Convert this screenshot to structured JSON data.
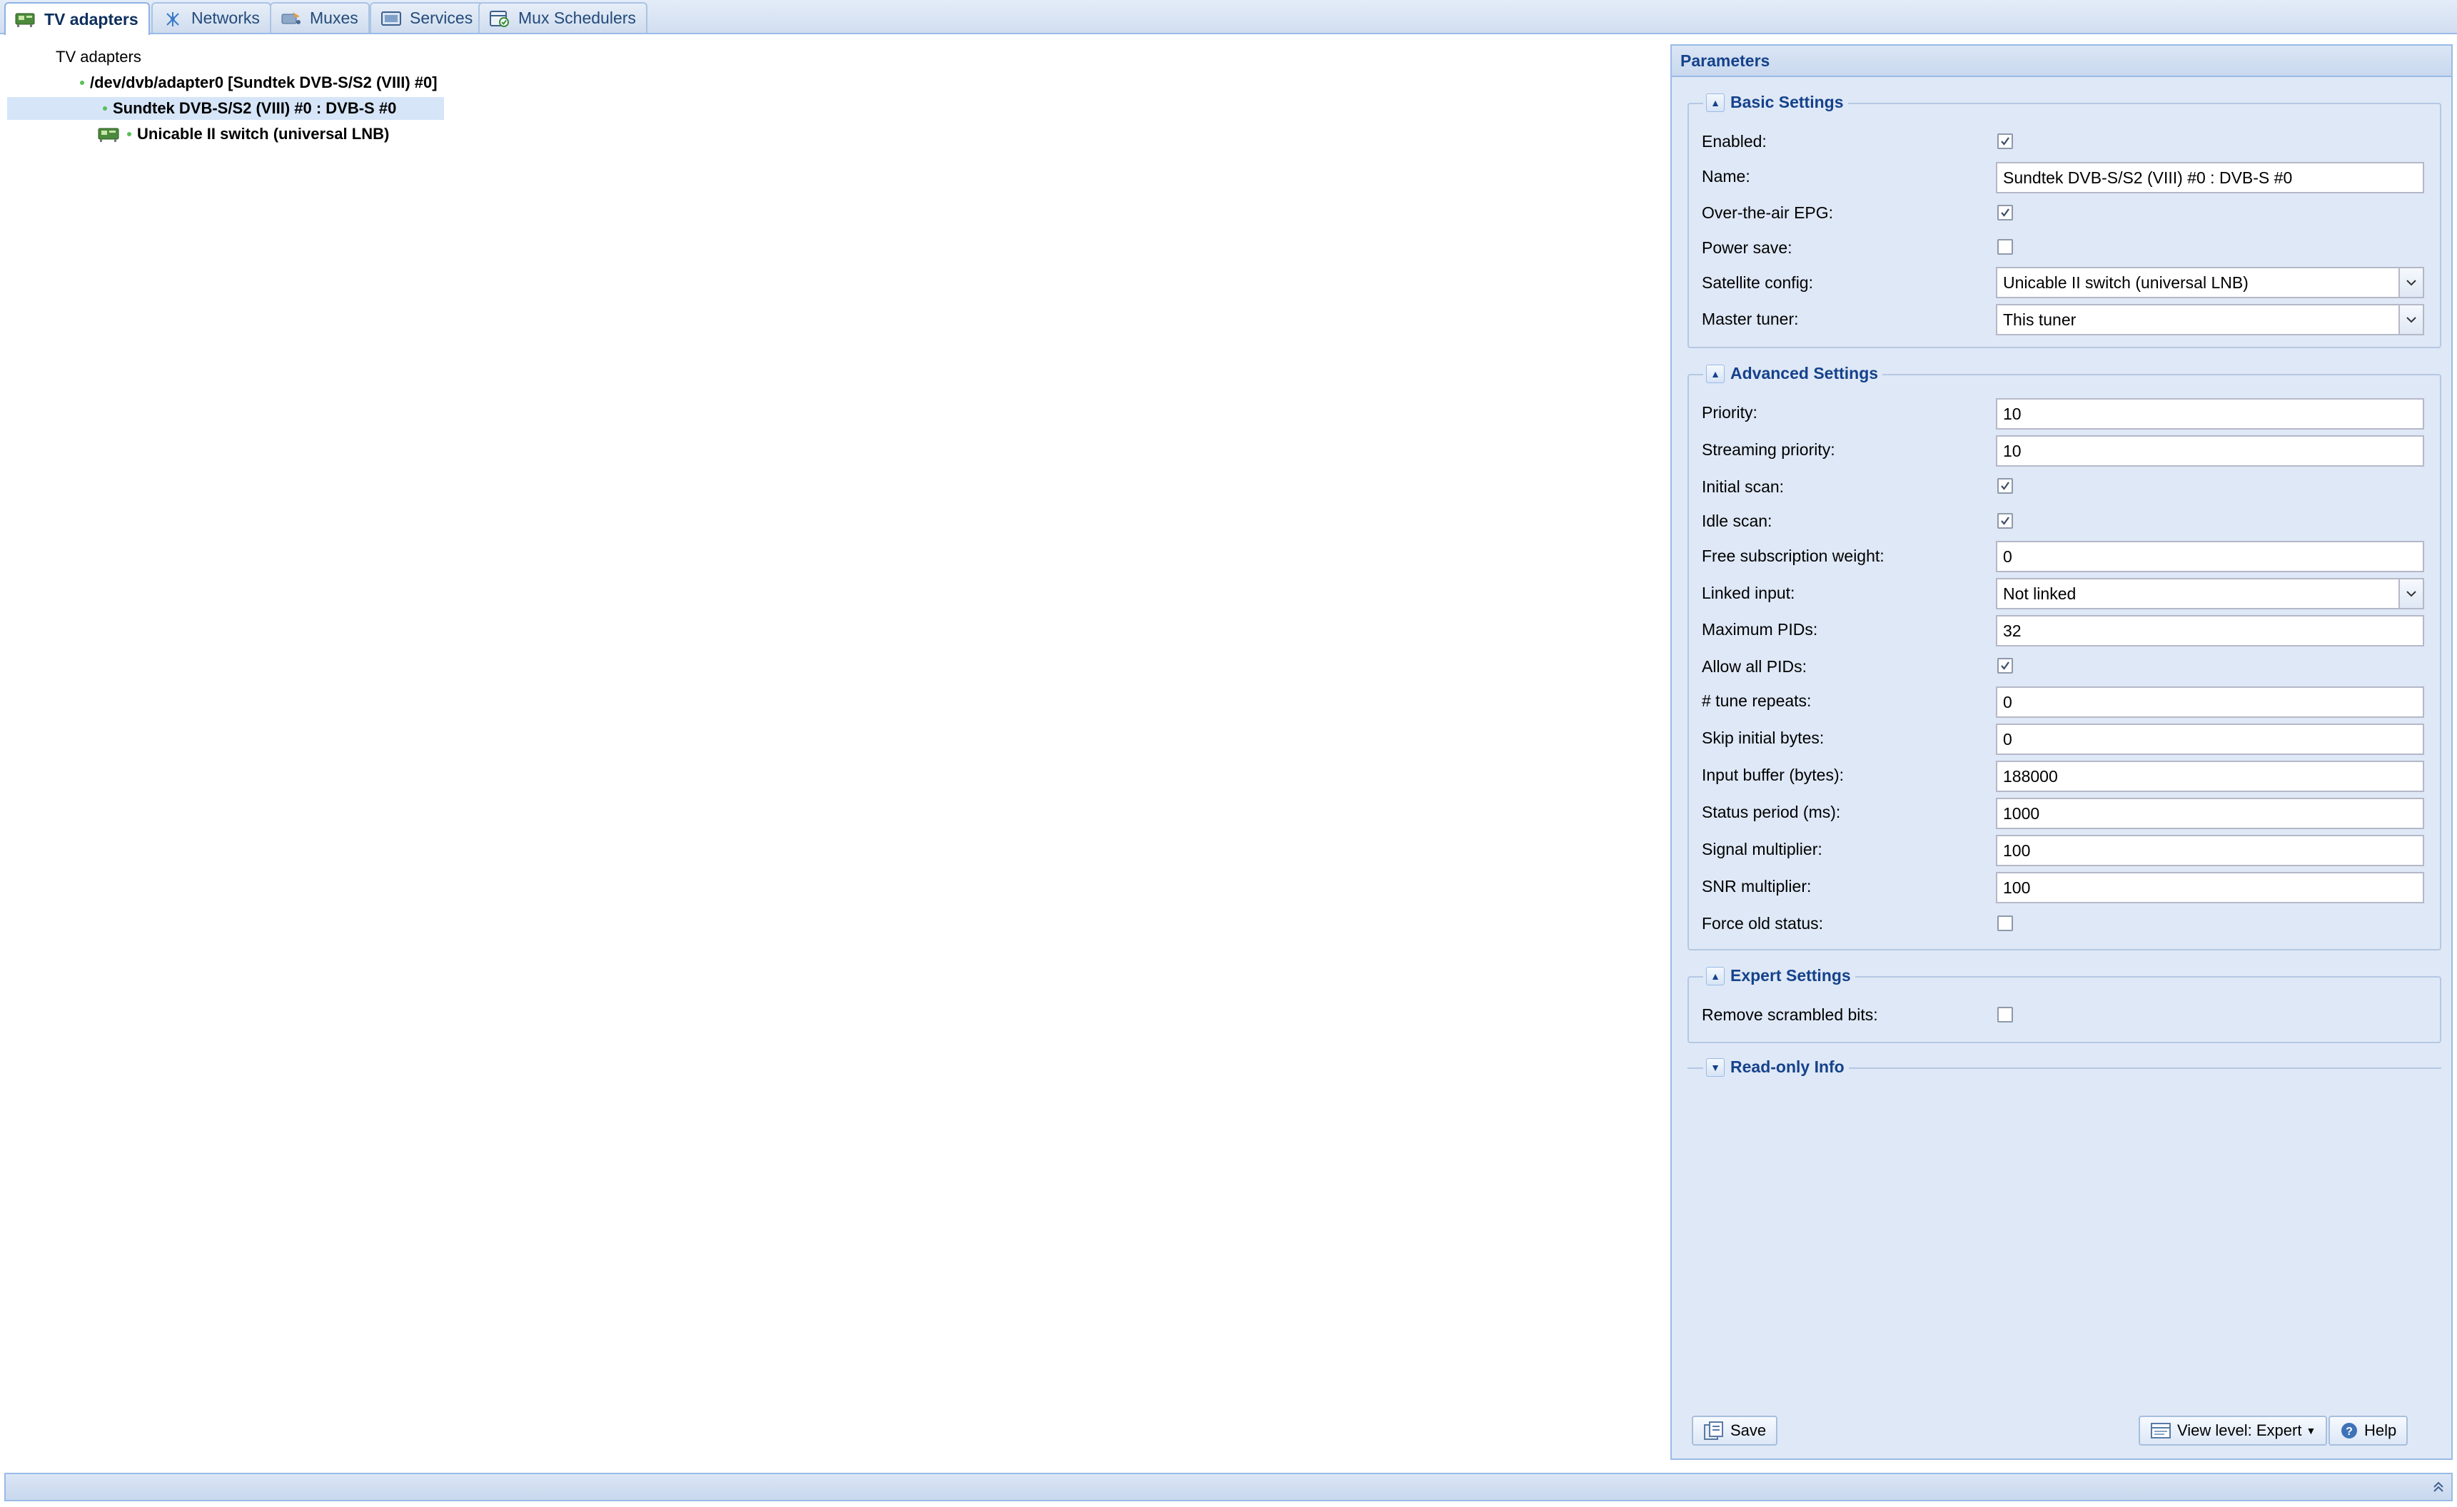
{
  "tabs": [
    {
      "label": "TV adapters",
      "icon": "tv-adapter-icon",
      "active": true
    },
    {
      "label": "Networks",
      "icon": "network-icon",
      "active": false
    },
    {
      "label": "Muxes",
      "icon": "mux-icon",
      "active": false
    },
    {
      "label": "Services",
      "icon": "services-icon",
      "active": false
    },
    {
      "label": "Mux Schedulers",
      "icon": "scheduler-icon",
      "active": false
    }
  ],
  "tree": {
    "root": "TV adapters",
    "adapter": "/dev/dvb/adapter0 [Sundtek DVB-S/S2 (VIII) #0]",
    "frontend": "Sundtek DVB-S/S2 (VIII) #0 : DVB-S #0",
    "satconf": "Unicable II switch (universal LNB)"
  },
  "panel": {
    "title": "Parameters",
    "basic": {
      "legend": "Basic Settings",
      "enabled_label": "Enabled:",
      "enabled": true,
      "name_label": "Name:",
      "name_value": "Sundtek DVB-S/S2 (VIII) #0 : DVB-S #0",
      "epg_label": "Over-the-air EPG:",
      "epg": true,
      "powersave_label": "Power save:",
      "powersave": false,
      "satconfig_label": "Satellite config:",
      "satconfig_value": "Unicable II switch (universal LNB)",
      "master_label": "Master tuner:",
      "master_value": "This tuner"
    },
    "advanced": {
      "legend": "Advanced Settings",
      "priority_label": "Priority:",
      "priority_value": "10",
      "streaming_label": "Streaming priority:",
      "streaming_value": "10",
      "initial_scan_label": "Initial scan:",
      "initial_scan": true,
      "idle_scan_label": "Idle scan:",
      "idle_scan": true,
      "free_sub_label": "Free subscription weight:",
      "free_sub_value": "0",
      "linked_label": "Linked input:",
      "linked_value": "Not linked",
      "max_pids_label": "Maximum PIDs:",
      "max_pids_value": "32",
      "allow_pids_label": "Allow all PIDs:",
      "allow_pids": true,
      "tune_label": "# tune repeats:",
      "tune_value": "0",
      "skip_label": "Skip initial bytes:",
      "skip_value": "0",
      "buffer_label": "Input buffer (bytes):",
      "buffer_value": "188000",
      "status_label": "Status period (ms):",
      "status_value": "1000",
      "signal_label": "Signal multiplier:",
      "signal_value": "100",
      "snr_label": "SNR multiplier:",
      "snr_value": "100",
      "force_label": "Force old status:",
      "force": false
    },
    "expert": {
      "legend": "Expert Settings",
      "remove_label": "Remove scrambled bits:",
      "remove": false
    },
    "readonly": {
      "legend": "Read-only Info"
    },
    "toolbar": {
      "save": "Save",
      "view_level": "View level: Expert",
      "help": "Help"
    }
  },
  "colors": {
    "accent": "#15428b",
    "panel_bg": "#dfe8f6",
    "border": "#99bbe8",
    "status_ok": "#58c058"
  }
}
